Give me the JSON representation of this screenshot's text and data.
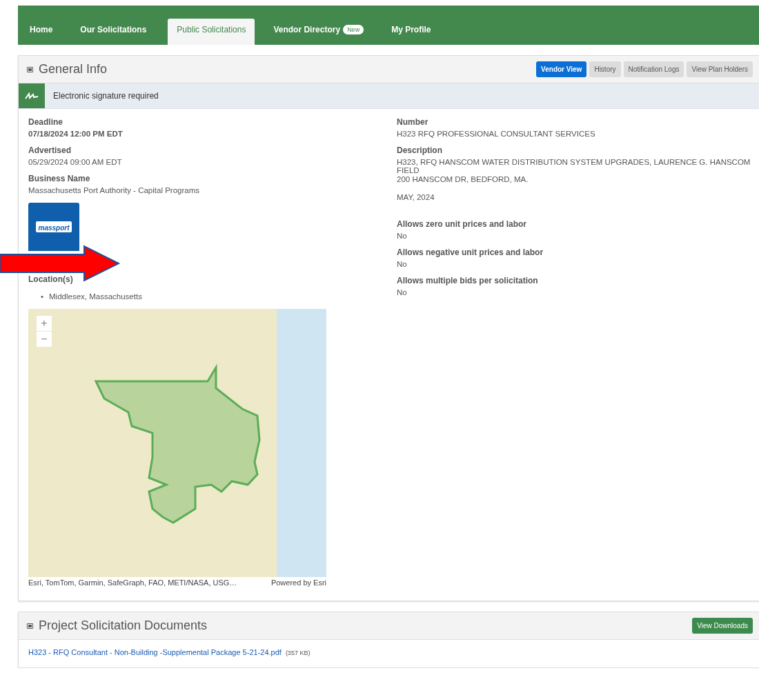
{
  "nav": {
    "tabs": [
      {
        "label": "Home",
        "selected": false
      },
      {
        "label": "Our Solicitations",
        "selected": false
      },
      {
        "label": "Public Solicitations",
        "selected": true
      },
      {
        "label": "Vendor Directory",
        "badge": "New",
        "selected": false
      },
      {
        "label": "My Profile",
        "selected": false
      }
    ]
  },
  "general_info": {
    "title": "General Info",
    "expanded": true,
    "buttons": [
      {
        "label": "Vendor View",
        "kind": "primary"
      },
      {
        "label": "History",
        "kind": "default"
      },
      {
        "label": "Notification Logs",
        "kind": "default"
      },
      {
        "label": "View Plan Holders",
        "kind": "default"
      }
    ],
    "notice": "Electronic signature required",
    "left_fields": [
      {
        "label": "Deadline",
        "value": "07/18/2024 12:00 PM EDT",
        "bold": true
      },
      {
        "label": "Advertised",
        "value": "05/29/2024 09:00 AM EDT",
        "bold": false
      },
      {
        "label": "Business Name",
        "value": "Massachusetts Port Authority - Capital Programs",
        "bold": false
      }
    ],
    "logo_text": "massport",
    "locations_label": "Location(s)",
    "locations": [
      {
        "bullet": "•",
        "text": "Middlesex, Massachusetts"
      }
    ],
    "map": {
      "zoom_in": "+",
      "zoom_out": "−",
      "attribution": "Esri, TomTom, Garmin, SafeGraph, FAO, METI/NASA, USG…",
      "powered_by": "Powered by Esri"
    },
    "right_fields": [
      {
        "label": "Number",
        "lines": [
          "H323 RFQ PROFESSIONAL CONSULTANT SERVICES"
        ]
      },
      {
        "label": "Description",
        "lines": [
          "H323, RFQ HANSCOM WATER DISTRIBUTION SYSTEM UPGRADES, LAURENCE G. HANSCOM FIELD",
          "200 HANSCOM DR, BEDFORD, MA."
        ],
        "note": "MAY, 2024"
      },
      {
        "label": "Allows zero unit prices and labor",
        "lines": [
          "No"
        ]
      },
      {
        "label": "Allows negative unit prices and labor",
        "lines": [
          "No"
        ]
      },
      {
        "label": "Allows multiple bids per solicitation",
        "lines": [
          "No"
        ]
      }
    ]
  },
  "documents": {
    "title": "Project Solicitation Documents",
    "expanded": true,
    "button": "View Downloads",
    "files": [
      {
        "name": "H323 - RFQ Consultant - Non-Building -Supplemental Package 5-21-24.pdf",
        "size": "(357 KB)"
      }
    ]
  }
}
